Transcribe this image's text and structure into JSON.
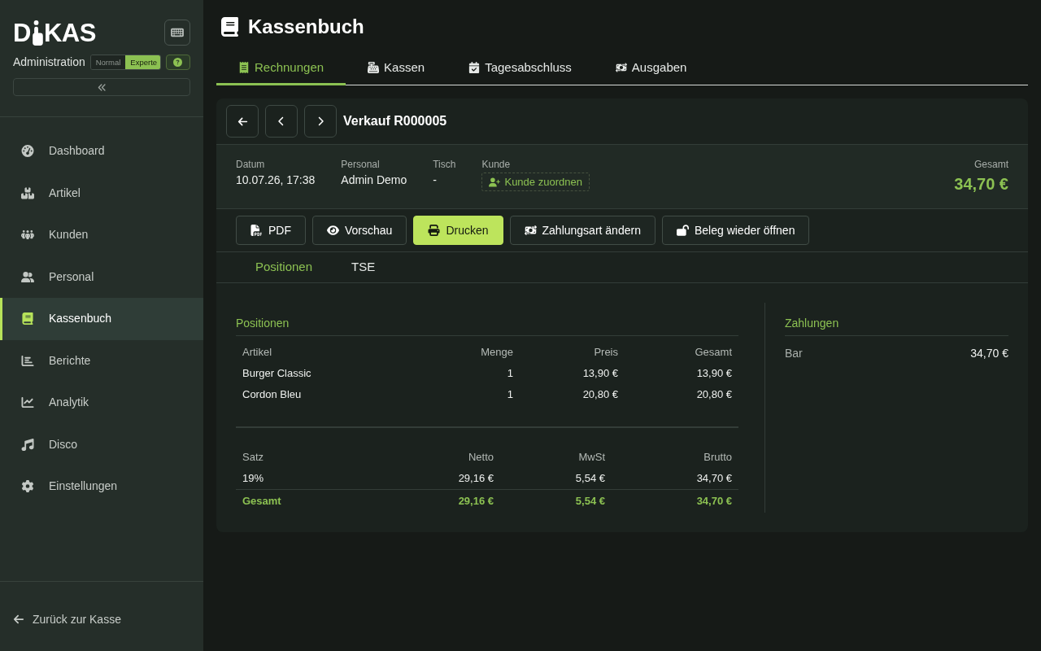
{
  "sidebar": {
    "logo": {
      "start": "D",
      "end": "KAS"
    },
    "subtitle": "Administration",
    "mode_switch": [
      {
        "label": "Normal",
        "selected": false
      },
      {
        "label": "Experte",
        "selected": true
      }
    ],
    "items": [
      {
        "label": "Dashboard",
        "selected": false
      },
      {
        "label": "Artikel",
        "selected": false
      },
      {
        "label": "Kunden",
        "selected": false
      },
      {
        "label": "Personal",
        "selected": false
      },
      {
        "label": "Kassenbuch",
        "selected": true
      },
      {
        "label": "Berichte",
        "selected": false
      },
      {
        "label": "Analytik",
        "selected": false
      },
      {
        "label": "Disco",
        "selected": false
      },
      {
        "label": "Einstellungen",
        "selected": false
      }
    ],
    "back_link": "Zurück zur Kasse"
  },
  "header": {
    "title": "Kassenbuch"
  },
  "tabs": [
    {
      "label": "Rechnungen",
      "selected": true
    },
    {
      "label": "Kassen",
      "selected": false
    },
    {
      "label": "Tagesabschluss",
      "selected": false
    },
    {
      "label": "Ausgaben",
      "selected": false
    }
  ],
  "receipt": {
    "title": "Verkauf R000005",
    "fields": [
      {
        "label": "Datum",
        "value": "10.07.26, 17:38"
      },
      {
        "label": "Personal",
        "value": "Admin Demo"
      },
      {
        "label": "Tisch",
        "value": "-"
      }
    ],
    "customer": {
      "label": "Kunde",
      "action": "Kunde zuordnen"
    },
    "total": {
      "label": "Gesamt",
      "value": "34,70 €"
    },
    "actions": [
      {
        "label": "PDF",
        "primary": false
      },
      {
        "label": "Vorschau",
        "primary": false
      },
      {
        "label": "Drucken",
        "primary": true
      },
      {
        "label": "Zahlungsart ändern",
        "primary": false
      },
      {
        "label": "Beleg wieder öffnen",
        "primary": false
      }
    ],
    "subtabs": [
      {
        "label": "Positionen",
        "selected": true
      },
      {
        "label": "TSE",
        "selected": false
      }
    ],
    "positions": {
      "title": "Positionen",
      "columns": [
        "Artikel",
        "Menge",
        "Preis",
        "Gesamt"
      ],
      "rows": [
        [
          "Burger Classic",
          "1",
          "13,90 €",
          "13,90 €"
        ],
        [
          "Cordon Bleu",
          "1",
          "20,80 €",
          "20,80 €"
        ]
      ]
    },
    "taxes": {
      "columns": [
        "Satz",
        "Netto",
        "MwSt",
        "Brutto"
      ],
      "rows": [
        [
          "19%",
          "29,16 €",
          "5,54 €",
          "34,70 €"
        ]
      ],
      "total": [
        "Gesamt",
        "29,16 €",
        "5,54 €",
        "34,70 €"
      ]
    },
    "payments": {
      "title": "Zahlungen",
      "rows": [
        {
          "method": "Bar",
          "amount": "34,70 €"
        }
      ]
    }
  }
}
